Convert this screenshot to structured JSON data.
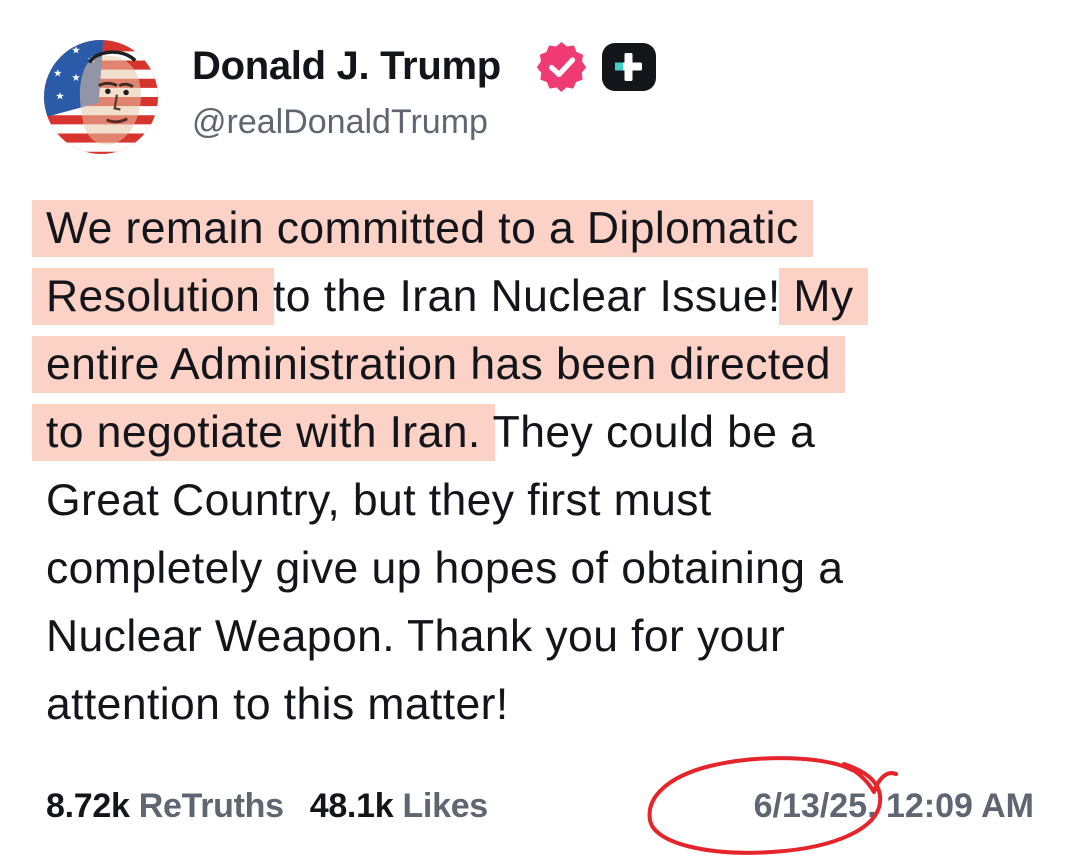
{
  "author": {
    "display_name": "Donald J. Trump",
    "handle": "@realDonaldTrump",
    "verified_icon": "verified-badge-icon",
    "plus_icon": "truth-plus-icon"
  },
  "post": {
    "lines": [
      [
        {
          "t": "We remain committed to a Diplomatic",
          "hl": true
        }
      ],
      [
        {
          "t": "Resolution",
          "hl": true
        },
        {
          "t": " to the Iran Nuclear Issue! ",
          "hl": false
        },
        {
          "t": "My",
          "hl": true
        }
      ],
      [
        {
          "t": "entire Administration has been directed",
          "hl": true
        }
      ],
      [
        {
          "t": "to negotiate with Iran.",
          "hl": true
        },
        {
          "t": " They could be a",
          "hl": false
        }
      ],
      [
        {
          "t": "Great Country, but they first must",
          "hl": false
        }
      ],
      [
        {
          "t": "completely give up hopes of obtaining a",
          "hl": false
        }
      ],
      [
        {
          "t": "Nuclear Weapon. Thank you for your",
          "hl": false
        }
      ],
      [
        {
          "t": "attention to this matter!",
          "hl": false
        }
      ]
    ]
  },
  "stats": {
    "retruths_count": "8.72k",
    "retruths_label": "ReTruths",
    "likes_count": "48.1k",
    "likes_label": "Likes"
  },
  "timestamp": "6/13/25, 12:09 AM",
  "colors": {
    "highlight": "#fbd2c5",
    "verified": "#f03a73",
    "annotation_circle": "#e5242b",
    "muted_text": "#606671"
  }
}
